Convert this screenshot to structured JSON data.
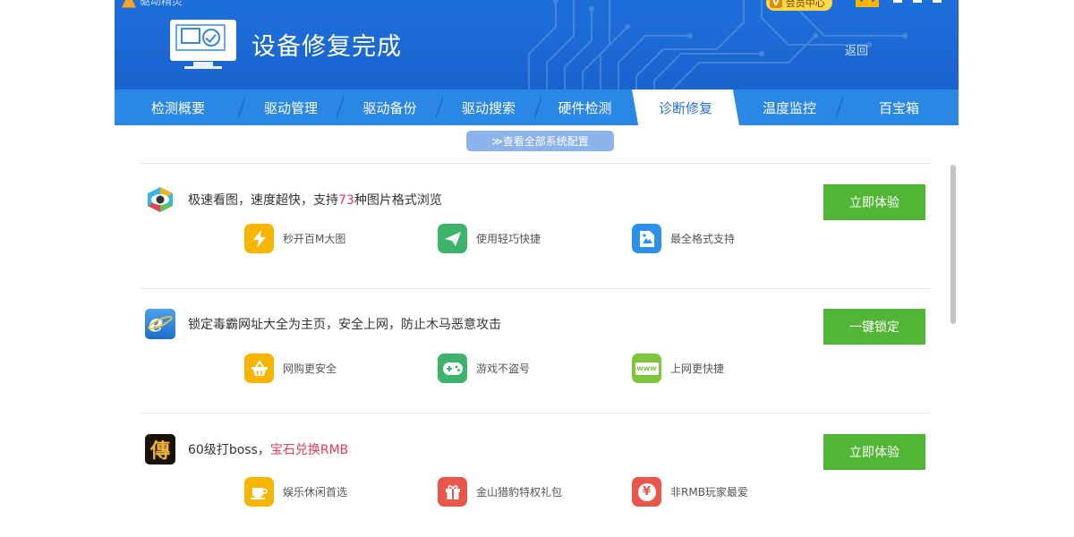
{
  "app": {
    "name": "驱动精灵"
  },
  "header": {
    "vip_label": "会员中心",
    "vip_tag": "V",
    "title": "设备修复完成",
    "back_label": "返回"
  },
  "tabs": [
    {
      "label": "检测概要",
      "active": false
    },
    {
      "label": "驱动管理",
      "active": false
    },
    {
      "label": "驱动备份",
      "active": false
    },
    {
      "label": "驱动搜索",
      "active": false
    },
    {
      "label": "硬件检测",
      "active": false
    },
    {
      "label": "诊断修复",
      "active": true
    },
    {
      "label": "温度监控",
      "active": false
    },
    {
      "label": "百宝箱",
      "active": false
    }
  ],
  "view_all": {
    "label": "≫查看全部系统配置"
  },
  "promos": [
    {
      "icon": "eye-viewer-icon",
      "title_pre": "极速看图，速度超快，支持",
      "title_hl": "73",
      "title_post": "种图片格式浏览",
      "button": "立即体验",
      "features": [
        {
          "icon": "lightning-icon",
          "color": "#f7b500",
          "label": "秒开百M大图"
        },
        {
          "icon": "paper-plane-icon",
          "color": "#3db36b",
          "label": "使用轻巧快捷"
        },
        {
          "icon": "image-file-icon",
          "color": "#2b92e8",
          "label": "最全格式支持"
        }
      ]
    },
    {
      "icon": "ie-browser-icon",
      "title_pre": "锁定毒霸网址大全为主页，安全上网，防止木马恶意攻击",
      "title_hl": "",
      "title_post": "",
      "button": "一键锁定",
      "features": [
        {
          "icon": "basket-icon",
          "color": "#f7b500",
          "label": "网购更安全"
        },
        {
          "icon": "gamepad-icon",
          "color": "#3db36b",
          "label": "游戏不盗号"
        },
        {
          "icon": "www-icon",
          "color": "#7dc63c",
          "label": "上网更快捷"
        }
      ]
    },
    {
      "icon": "legend-game-icon",
      "title_pre": "60级打boss，",
      "title_hl": "宝石兑换RMB",
      "title_post": "",
      "button": "立即体验",
      "features": [
        {
          "icon": "coffee-cup-icon",
          "color": "#f7b500",
          "label": "娱乐休闲首选"
        },
        {
          "icon": "gift-icon",
          "color": "#e8574a",
          "label": "金山猎豹特权礼包"
        },
        {
          "icon": "yuan-icon",
          "color": "#e8574a",
          "label": "非RMB玩家最爱"
        }
      ]
    }
  ]
}
